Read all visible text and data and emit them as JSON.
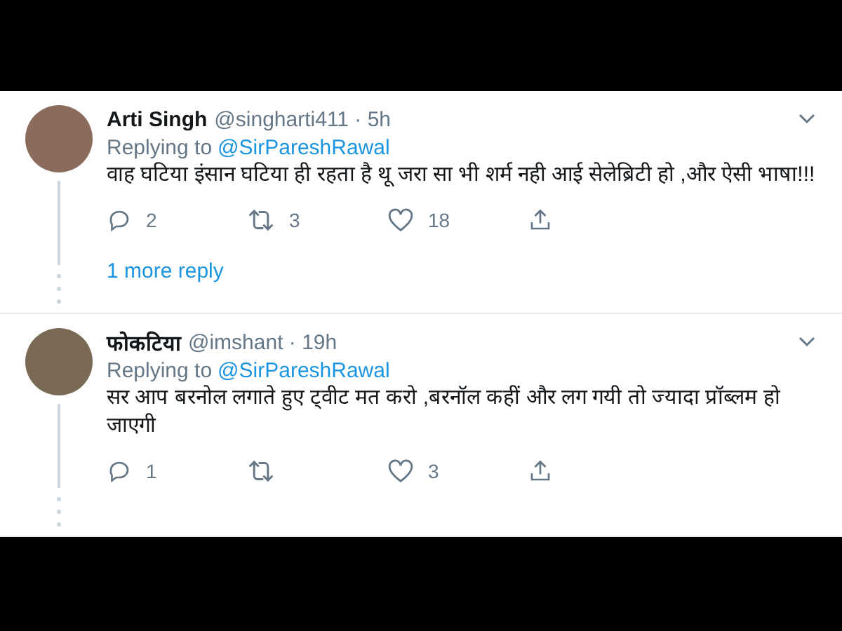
{
  "tweets": [
    {
      "author": "Arti Singh",
      "meta": "@singharti411 · 5h",
      "replying_label": "Replying to",
      "replying_to": "@SirPareshRawal",
      "text": "वाह घटिया इंसान घटिया ही रहता है थू जरा सा भी शर्म नही आई सेलेब्रिटी हो ,और ऐसी भाषा!!!",
      "actions": [
        {
          "kind": "reply",
          "count": "2"
        },
        {
          "kind": "retweet",
          "count": "3"
        },
        {
          "kind": "like",
          "count": "18"
        },
        {
          "kind": "share"
        }
      ],
      "more_replies": "1 more reply"
    },
    {
      "author": "फोकटिया",
      "meta": "@imshant · 19h",
      "replying_label": "Replying to",
      "replying_to": "@SirPareshRawal",
      "text": "सर आप बरनोल लगाते हुए ट्वीट मत करो ,बरनॉल कहीं और लग गयी तो ज्यादा प्रॉब्लम हो जाएगी",
      "actions": [
        {
          "kind": "reply",
          "count": "1"
        },
        {
          "kind": "retweet"
        },
        {
          "kind": "like",
          "count": "3"
        },
        {
          "kind": "share"
        }
      ]
    }
  ]
}
